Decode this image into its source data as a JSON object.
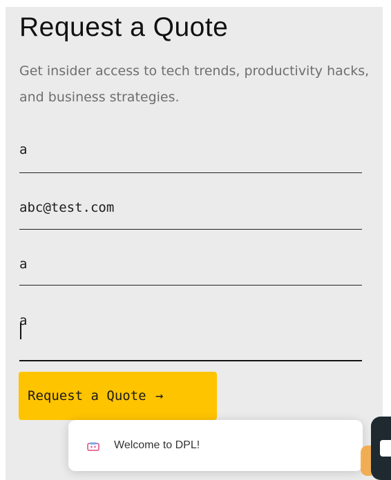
{
  "form": {
    "title": "Request a Quote",
    "subtitle": "Get insider access to tech trends, productivity hacks, and business strategies.",
    "fields": [
      {
        "value": "a"
      },
      {
        "value": "abc@test.com"
      },
      {
        "value": "a"
      },
      {
        "value": "a"
      }
    ],
    "submit_label": "Request a Quote",
    "submit_arrow": "→"
  },
  "toast": {
    "message": "Welcome to DPL!",
    "icon": "chat-bot-icon"
  },
  "chat_launcher": {
    "icon": "chat-bubble-icon"
  },
  "colors": {
    "panel_bg": "#ebebeb",
    "button_bg": "#ffc400",
    "launcher_bg": "#1e2a2f"
  }
}
